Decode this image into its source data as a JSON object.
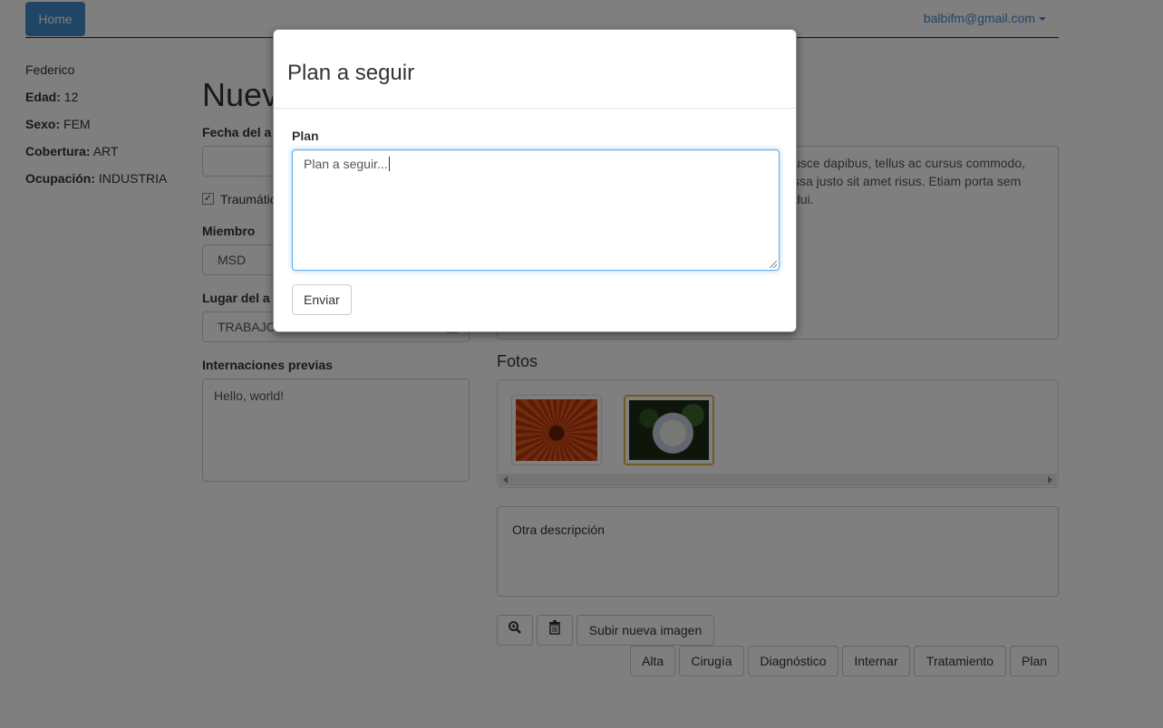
{
  "nav": {
    "home_label": "Home",
    "user_email": "balbifm@gmail.com"
  },
  "patient": {
    "name": "Federico",
    "age_label": "Edad:",
    "age": "12",
    "sex_label": "Sexo:",
    "sex": "FEM",
    "coverage_label": "Cobertura:",
    "coverage": "ART",
    "occupation_label": "Ocupación:",
    "occupation": "INDUSTRIA"
  },
  "form": {
    "heading": "Nuev",
    "fecha_label": "Fecha del a",
    "fecha_value": "",
    "traumatic_checked": true,
    "traumatic_label": "Traumátic",
    "miembro_label": "Miembro",
    "miembro_value": "MSD",
    "lugar_label": "Lugar del a",
    "lugar_value": "TRABAJO",
    "internaciones_label": "Internaciones previas",
    "internaciones_value": "Hello, world!",
    "right_text": "usce dapibus, tellus ac cursus commodo, ssa justo sit amet risus. Etiam porta sem dui."
  },
  "fotos": {
    "title": "Fotos",
    "description": "Otra descripción",
    "upload_label": "Subir nueva imagen"
  },
  "actions": [
    "Alta",
    "Cirugía",
    "Diagnóstico",
    "Internar",
    "Tratamiento",
    "Plan"
  ],
  "modal": {
    "title": "Plan a seguir",
    "field_label": "Plan",
    "textarea_value": "Plan a seguir...",
    "send_label": "Enviar"
  },
  "colors": {
    "primary": "#428bca",
    "focus_border": "#66afe9",
    "selected_thumb": "#e0b64a"
  }
}
